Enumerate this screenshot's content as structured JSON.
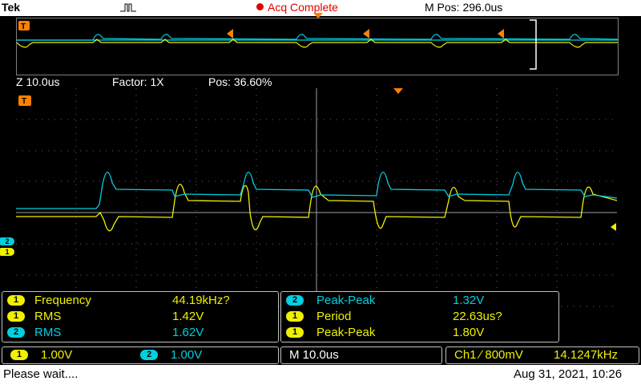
{
  "header": {
    "brand": "Tek",
    "acq_status": "Acq Complete",
    "m_pos": "M Pos: 296.0us"
  },
  "zoom": {
    "z_scale": "Z 10.0us",
    "factor": "Factor: 1X",
    "pos": "Pos: 36.60%"
  },
  "markers": {
    "trigger": "T",
    "ch1": "1",
    "ch2": "2"
  },
  "measurements_left": [
    {
      "ch": "1",
      "label": "Frequency",
      "value": "44.19kHz?"
    },
    {
      "ch": "1",
      "label": "RMS",
      "value": "1.42V"
    },
    {
      "ch": "2",
      "label": "RMS",
      "value": "1.62V"
    }
  ],
  "measurements_right": [
    {
      "ch": "2",
      "label": "Peak-Peak",
      "value": "1.32V"
    },
    {
      "ch": "1",
      "label": "Period",
      "value": "22.63us?"
    },
    {
      "ch": "1",
      "label": "Peak-Peak",
      "value": "1.80V"
    }
  ],
  "channels": {
    "ch1_scale": "1.00V",
    "ch2_scale": "1.00V",
    "timebase": "M 10.0us",
    "trigger_info": "Ch1 ∕ 800mV",
    "trigger_freq": "14.1247kHz"
  },
  "status": {
    "message": "Please wait....",
    "datetime": "Aug 31, 2021, 10:26"
  },
  "colors": {
    "ch1": "#f0f000",
    "ch2": "#00d0e0",
    "trigger": "#ff8000"
  }
}
